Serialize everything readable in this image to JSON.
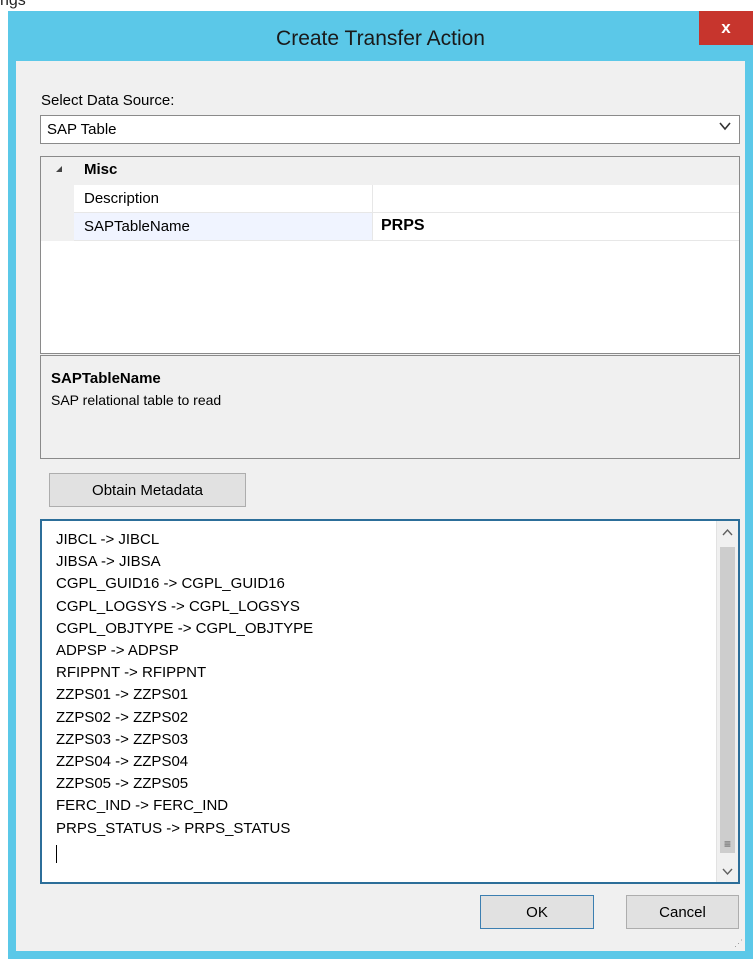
{
  "background_fragment": "ngs",
  "dialog": {
    "title": "Create Transfer Action",
    "close_glyph": "x",
    "select_label": "Select Data Source:",
    "data_source_value": "SAP Table",
    "property_grid": {
      "category": "Misc",
      "rows": [
        {
          "name": "Description",
          "value": ""
        },
        {
          "name": "SAPTableName",
          "value": "PRPS"
        }
      ]
    },
    "help": {
      "title": "SAPTableName",
      "description": "SAP relational table to read"
    },
    "obtain_metadata_label": "Obtain Metadata",
    "mappings": [
      "JIBCL -> JIBCL",
      "JIBSA -> JIBSA",
      "CGPL_GUID16 -> CGPL_GUID16",
      "CGPL_LOGSYS -> CGPL_LOGSYS",
      "CGPL_OBJTYPE -> CGPL_OBJTYPE",
      "ADPSP -> ADPSP",
      "RFIPPNT -> RFIPPNT",
      "ZZPS01 -> ZZPS01",
      "ZZPS02 -> ZZPS02",
      "ZZPS03 -> ZZPS03",
      "ZZPS04 -> ZZPS04",
      "ZZPS05 -> ZZPS05",
      "FERC_IND -> FERC_IND",
      "PRPS_STATUS -> PRPS_STATUS"
    ],
    "ok_label": "OK",
    "cancel_label": "Cancel"
  },
  "icons": {
    "close": "close-icon",
    "dropdown": "chevron-down-icon",
    "collapse": "triangle-collapse-icon",
    "scroll_up": "chevron-up-icon",
    "scroll_down": "chevron-down-icon"
  },
  "colors": {
    "titlebar": "#5bc8e8",
    "close_button": "#c7352d",
    "client_bg": "#f0f0f0",
    "textarea_border": "#2c6e99"
  }
}
